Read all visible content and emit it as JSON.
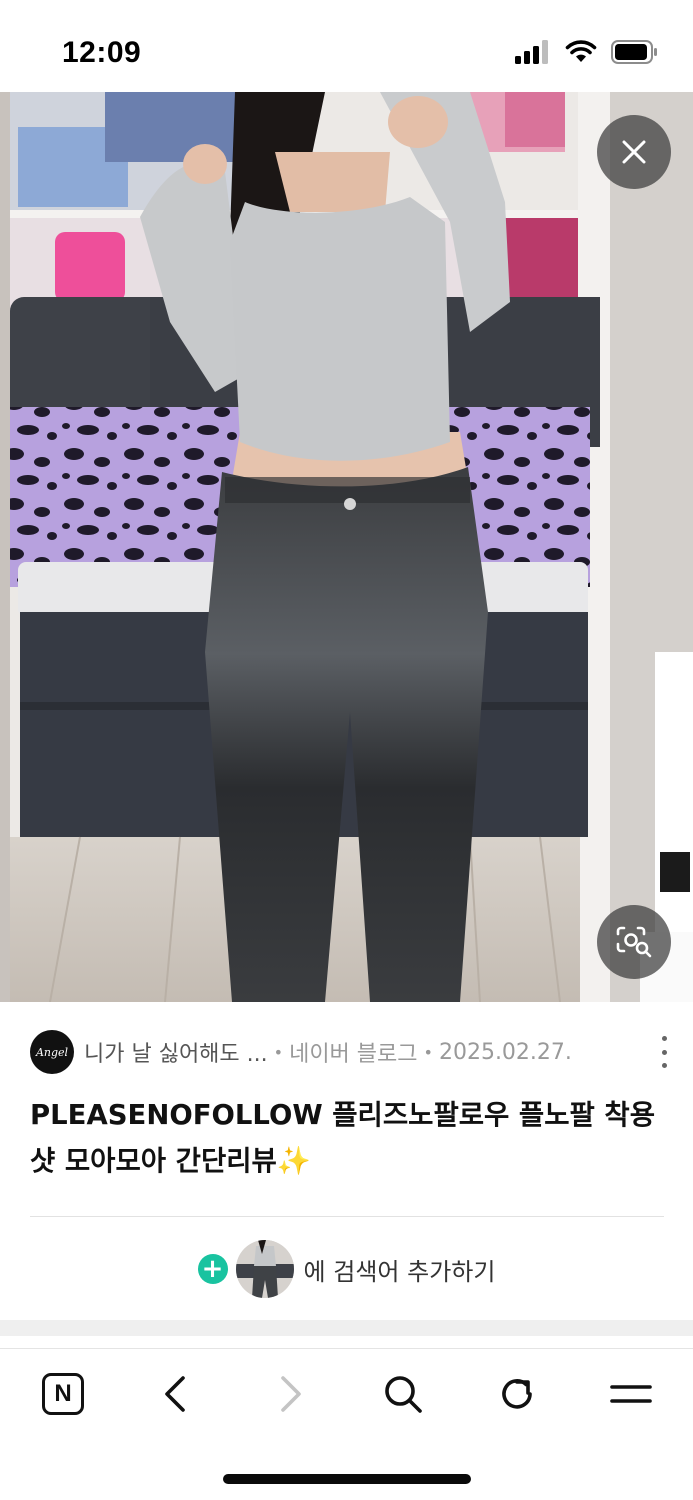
{
  "status_bar": {
    "time": "12:09",
    "icons": [
      "signal-icon",
      "wifi-icon",
      "battery-icon"
    ]
  },
  "image_viewer": {
    "overlay_icons": [
      "close-icon",
      "lens-search-icon"
    ]
  },
  "result": {
    "source_avatar_text": "Angel",
    "blog_name": "니가 날 싫어해도 ...",
    "separator": "•",
    "platform": "네이버 블로그",
    "date": "2025.02.27.",
    "title": "PLEASENOFOLLOW 플리즈노팔로우 플노팔 착용샷 모아모아 간단리뷰✨"
  },
  "add_search": {
    "plus": "+",
    "label": "에 검색어 추가하기"
  },
  "bottom_nav": {
    "n_label": "N",
    "items": [
      "naver-home-icon",
      "back-icon",
      "forward-icon",
      "search-icon",
      "refresh-icon",
      "menu-icon"
    ]
  },
  "colors": {
    "accent_green": "#19c3a0",
    "text_primary": "#111111",
    "text_meta": "#999999"
  }
}
